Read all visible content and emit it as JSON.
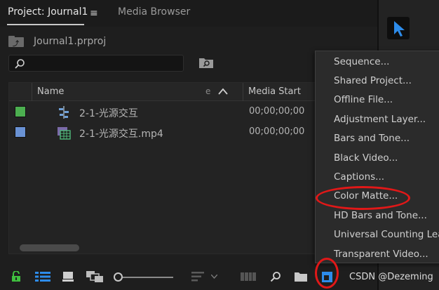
{
  "tabs": {
    "project": "Project: Journal1",
    "menu_glyph": "≡",
    "media_browser": "Media Browser"
  },
  "bin": {
    "name": "Journal1.prproj"
  },
  "search": {
    "value": "",
    "placeholder": ""
  },
  "table": {
    "columns": {
      "name": "Name",
      "truncated": "e",
      "media_start": "Media Start"
    },
    "rows": [
      {
        "name": "2-1-光源交互",
        "media_start": "00;00;00;00",
        "label_color": "#4caf50",
        "icon": "sequence-icon"
      },
      {
        "name": "2-1-光源交互.mp4",
        "media_start": "00;00;00;00",
        "label_color": "#6a92d4",
        "icon": "video-clip-icon"
      }
    ]
  },
  "menu": {
    "items": [
      "Sequence...",
      "Shared Project...",
      "Offline File...",
      "Adjustment Layer...",
      "Bars and Tone...",
      "Black Video...",
      "Captions...",
      "Color Matte...",
      "HD Bars and Tone...",
      "Universal Counting Lead",
      "Transparent Video..."
    ]
  },
  "watermark": "CSDN @Dezeming",
  "colors": {
    "accent_blue": "#2d8ceb",
    "lock_green": "#3fbf3f",
    "annotation_red": "#e01818"
  }
}
